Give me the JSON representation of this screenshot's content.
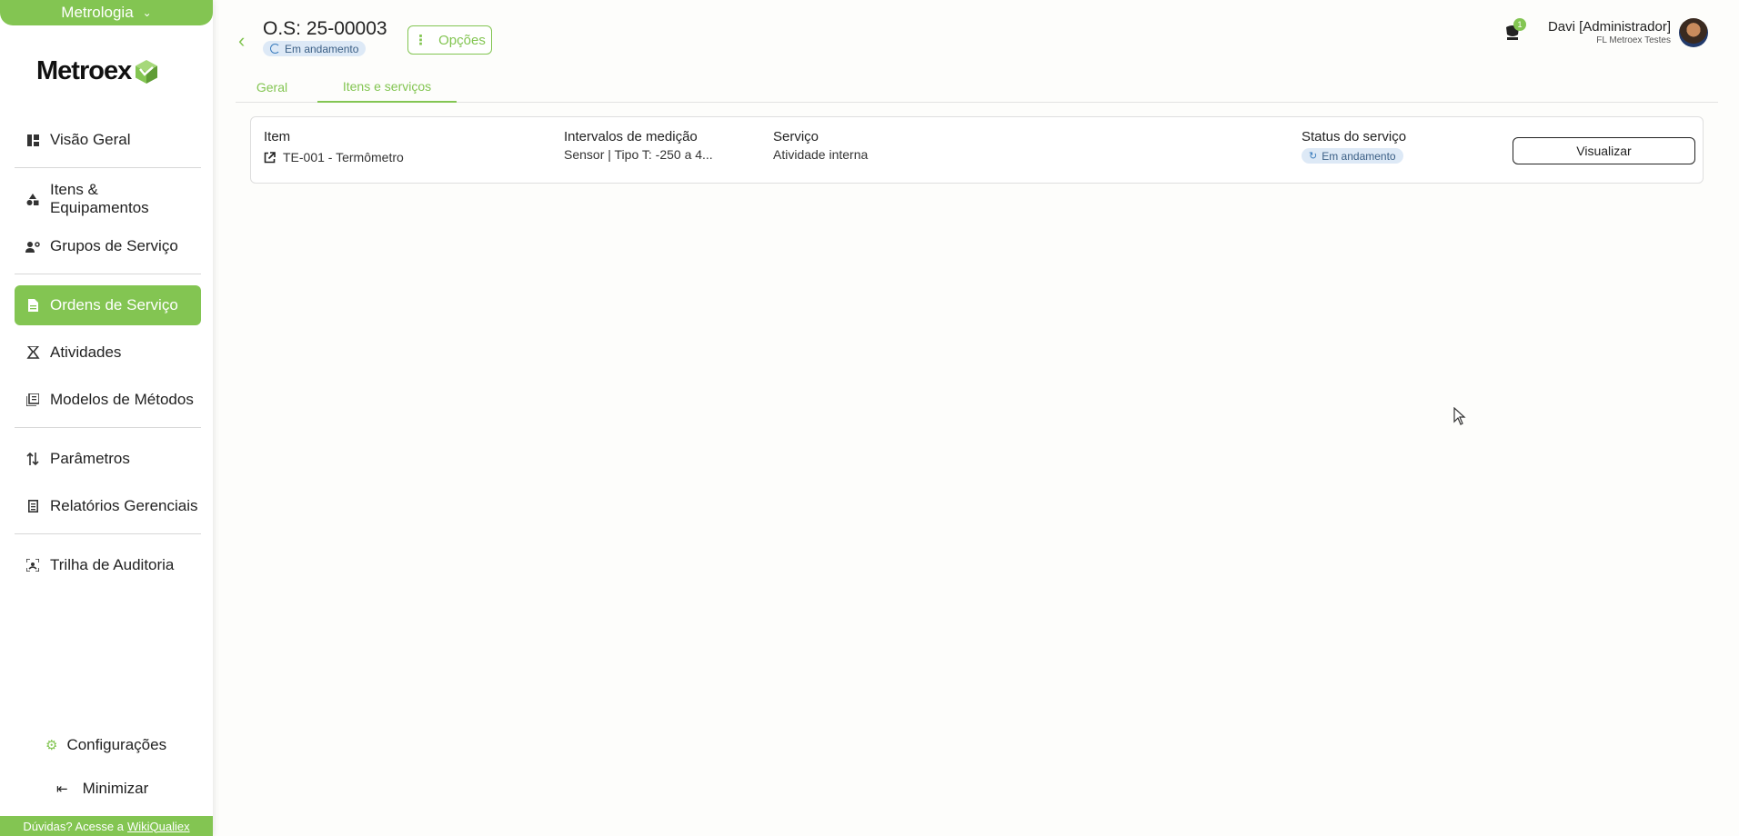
{
  "sidebar": {
    "module": "Metrologia",
    "logo_text": "Metroex",
    "items": [
      {
        "label": "Visão Geral",
        "icon": "dashboard-icon"
      },
      {
        "label": "Itens & Equipamentos",
        "icon": "shapes-icon"
      },
      {
        "label": "Grupos de Serviço",
        "icon": "users-gear-icon"
      },
      {
        "label": "Ordens de Serviço",
        "icon": "document-icon",
        "active": true
      },
      {
        "label": "Atividades",
        "icon": "activity-icon"
      },
      {
        "label": "Modelos de Métodos",
        "icon": "book-icon"
      },
      {
        "label": "Parâmetros",
        "icon": "sort-icon"
      },
      {
        "label": "Relatórios Gerenciais",
        "icon": "report-icon"
      },
      {
        "label": "Trilha de Auditoria",
        "icon": "audit-icon"
      }
    ],
    "config_label": "Configurações",
    "minimize_label": "Minimizar",
    "help_prefix": "Dúvidas? Acesse a",
    "help_link": "WikiQualiex"
  },
  "header": {
    "title": "O.S: 25-00003",
    "status": "Em andamento",
    "options_label": "Opções",
    "tabs": [
      {
        "label": "Geral"
      },
      {
        "label": "Itens e serviços",
        "active": true
      }
    ]
  },
  "user": {
    "name": "Davi [Administrador]",
    "company": "FL Metroex Testes",
    "notifications": "1"
  },
  "service_row": {
    "columns": {
      "item": "Item",
      "intervals": "Intervalos de medição",
      "service": "Serviço",
      "status": "Status do serviço"
    },
    "item": "TE-001 - Termômetro",
    "intervals": "Sensor | Tipo T: -250 a 4...",
    "service": "Atividade interna",
    "status": "Em andamento",
    "view_label": "Visualizar"
  },
  "colors": {
    "accent": "#83c552",
    "status_bg": "#dde9f6"
  }
}
